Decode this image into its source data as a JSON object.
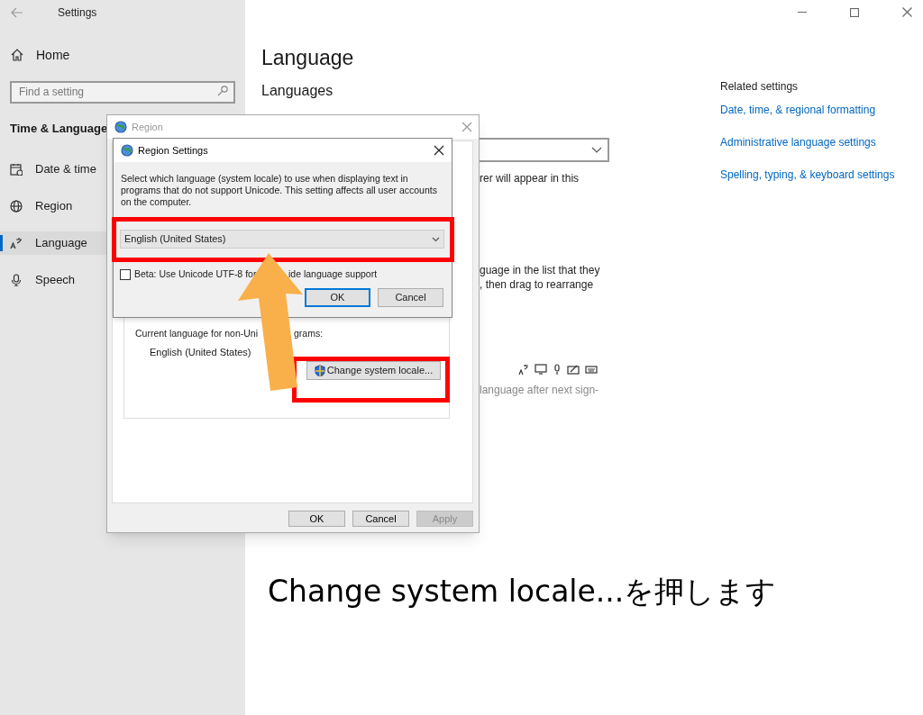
{
  "window": {
    "title": "Settings"
  },
  "sidebar": {
    "home": "Home",
    "search": {
      "placeholder": "Find a setting"
    },
    "section": "Time & Language",
    "items": [
      {
        "label": "Date & time",
        "kind": "calendar",
        "selected": false
      },
      {
        "label": "Region",
        "kind": "globe",
        "selected": false
      },
      {
        "label": "Language",
        "kind": "language",
        "selected": true
      },
      {
        "label": "Speech",
        "kind": "microphone",
        "selected": false
      }
    ]
  },
  "main": {
    "heading": "Language",
    "subheading": "Languages",
    "fragments": [
      {
        "text": "rer will appear in this",
        "muted": false
      },
      {
        "text": "guage in the list that they",
        "muted": false
      },
      {
        "text": ", then drag to rearrange",
        "muted": false
      },
      {
        "text": "language after next sign-",
        "muted": true
      }
    ]
  },
  "related_settings": {
    "title": "Related settings",
    "links": [
      "Date, time, & regional formatting",
      "Administrative language settings",
      "Spelling, typing, & keyboard settings"
    ]
  },
  "region_dialog": {
    "title": "Region",
    "group_label_parts": [
      "Current language for non-Uni",
      "grams:"
    ],
    "group_value": "English (United States)",
    "change_button": "Change system locale...",
    "buttons": [
      {
        "label": "OK",
        "disabled": false
      },
      {
        "label": "Cancel",
        "disabled": false
      },
      {
        "label": "Apply",
        "disabled": true
      }
    ]
  },
  "region_settings_dialog": {
    "title": "Region Settings",
    "description": "Select which language (system locale) to use when displaying text in programs that do not support Unicode. This setting affects all user accounts on the computer.",
    "locale_value": "English (United States)",
    "beta": {
      "label_parts": [
        "Beta: Use Unicode UTF-8 for",
        "ide language support"
      ],
      "checked": false
    },
    "buttons": [
      {
        "label": "OK",
        "default": true
      },
      {
        "label": "Cancel",
        "default": false
      }
    ]
  },
  "annotation": {
    "text": "Change system locale...を押します"
  }
}
